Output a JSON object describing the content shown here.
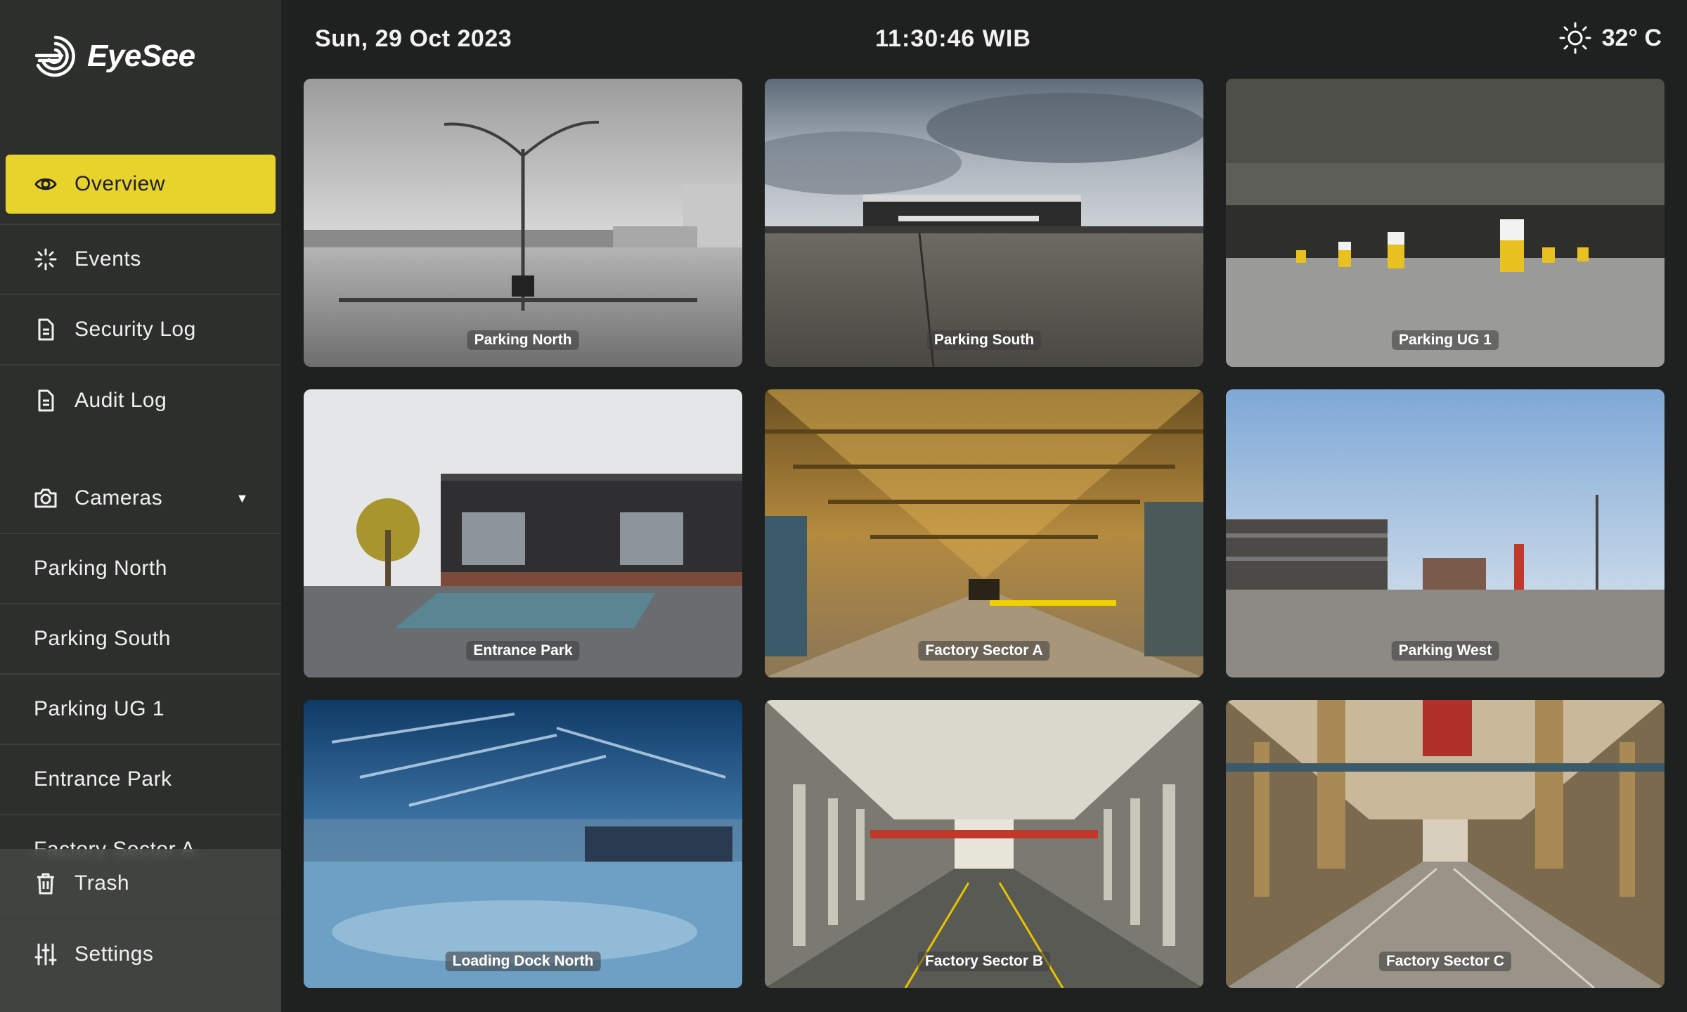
{
  "app": {
    "name": "EyeSee"
  },
  "header": {
    "date": "Sun, 29 Oct 2023",
    "time": "11:30:46 WIB",
    "temperature": "32° C",
    "weather_icon": "sun-icon"
  },
  "nav": {
    "overview": "Overview",
    "events": "Events",
    "security_log": "Security Log",
    "audit_log": "Audit Log",
    "cameras": "Cameras",
    "trash": "Trash",
    "settings": "Settings"
  },
  "cameras": [
    "Parking North",
    "Parking South",
    "Parking UG 1",
    "Entrance Park",
    "Factory Sector A"
  ],
  "feeds": [
    {
      "label": "Parking North"
    },
    {
      "label": "Parking South"
    },
    {
      "label": "Parking UG 1"
    },
    {
      "label": "Entrance Park"
    },
    {
      "label": "Factory Sector A"
    },
    {
      "label": "Parking West"
    },
    {
      "label": "Loading Dock North"
    },
    {
      "label": "Factory Sector B"
    },
    {
      "label": "Factory Sector C"
    }
  ],
  "colors": {
    "accent": "#e8d22c",
    "sidebar": "#2d2f2d",
    "background": "#1e211f"
  }
}
